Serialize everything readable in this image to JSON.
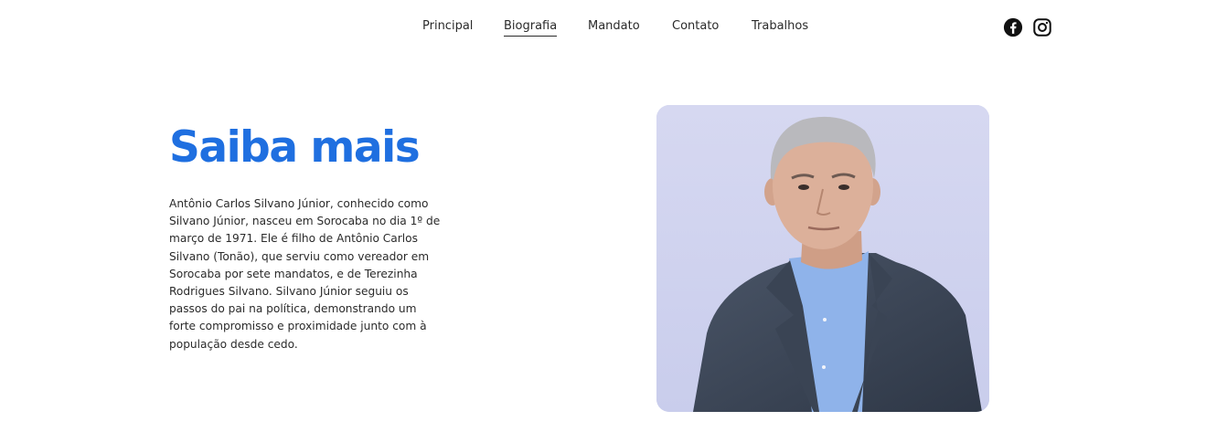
{
  "nav": {
    "items": [
      {
        "label": "Principal",
        "active": false
      },
      {
        "label": "Biografia",
        "active": true
      },
      {
        "label": "Mandato",
        "active": false
      },
      {
        "label": "Contato",
        "active": false
      },
      {
        "label": "Trabalhos",
        "active": false
      }
    ]
  },
  "social": {
    "icons": [
      "facebook-icon",
      "instagram-icon"
    ]
  },
  "main": {
    "title": "Saiba mais",
    "bio": "Antônio Carlos Silvano Júnior, conhecido como Silvano Júnior, nasceu em Sorocaba no dia 1º de março de 1971. Ele é filho de Antônio Carlos Silvano (Tonão), que serviu como vereador em Sorocaba por sete mandatos, e de Terezinha Rodrigues Silvano. Silvano Júnior seguiu os passos do pai na política, demonstrando um forte compromisso e proximidade junto com à população desde cedo."
  },
  "colors": {
    "accent": "#1f6fe0",
    "photo_background": "#d3d6ef"
  }
}
